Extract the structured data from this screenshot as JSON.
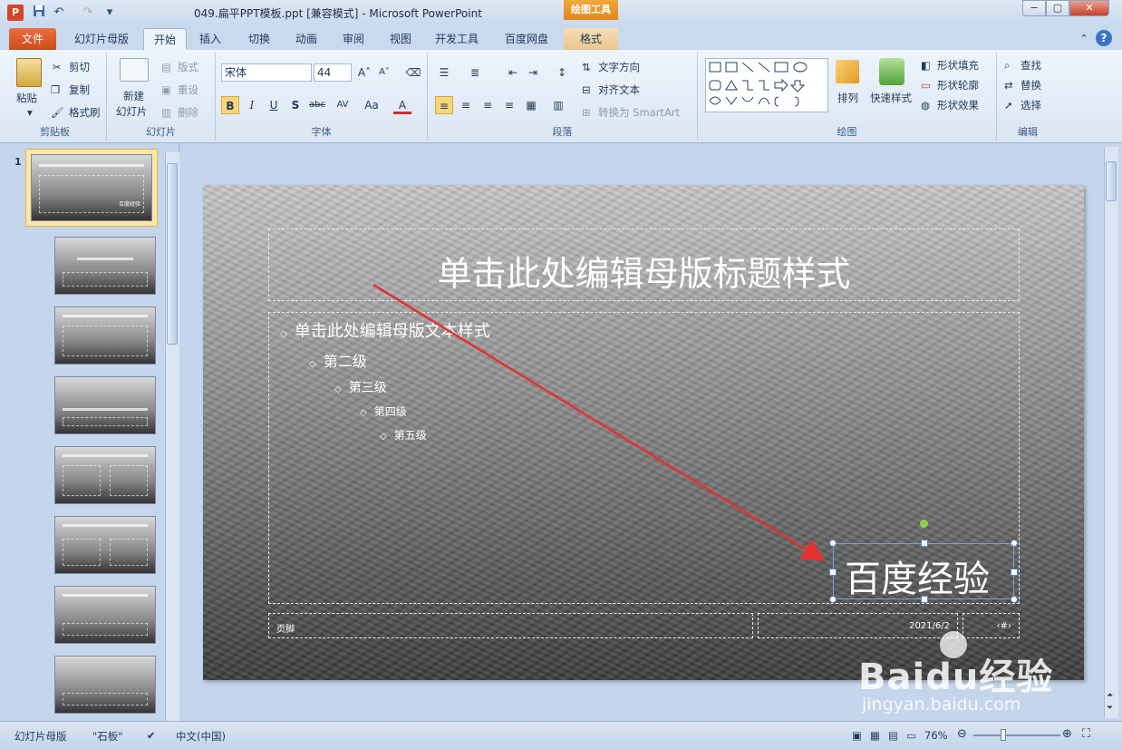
{
  "titlebar": {
    "app_icon_letter": "P",
    "doc_title": "049.扁平PPT模板.ppt [兼容模式] - Microsoft PowerPoint",
    "context_tool": "绘图工具",
    "minimize": "−",
    "maximize": "▢",
    "close": "✕"
  },
  "tabs": {
    "file": "文件",
    "slide_master": "幻灯片母版",
    "home": "开始",
    "insert": "插入",
    "transitions": "切换",
    "animations": "动画",
    "review": "审阅",
    "view": "视图",
    "developer": "开发工具",
    "baidu_disk": "百度网盘",
    "format": "格式"
  },
  "ribbon": {
    "clipboard": {
      "paste": "粘贴",
      "cut": "剪切",
      "copy": "复制",
      "format_painter": "格式刷",
      "label": "剪贴板"
    },
    "slides": {
      "new_slide_line1": "新建",
      "new_slide_line2": "幻灯片",
      "layout": "版式",
      "reset": "重设",
      "delete": "删除",
      "label": "幻灯片"
    },
    "font": {
      "font_name": "宋体",
      "font_size": "44",
      "bold": "B",
      "italic": "I",
      "underline": "U",
      "shadow": "S",
      "strike": "abc",
      "spacing": "AV",
      "case": "Aa",
      "color": "A",
      "label": "字体"
    },
    "paragraph": {
      "text_direction": "文字方向",
      "align_text": "对齐文本",
      "smartart": "转换为 SmartArt",
      "label": "段落"
    },
    "drawing": {
      "arrange": "排列",
      "quick_styles": "快速样式",
      "shape_fill": "形状填充",
      "shape_outline": "形状轮廓",
      "shape_effects": "形状效果",
      "label": "绘图"
    },
    "editing": {
      "find": "查找",
      "replace": "替换",
      "select": "选择",
      "label": "编辑"
    }
  },
  "thumbnails": {
    "first_number": "1",
    "first_caption": "百度经验"
  },
  "slide": {
    "title": "单击此处编辑母版标题样式",
    "levels": [
      "单击此处编辑母版文本样式",
      "第二级",
      "第三级",
      "第四级",
      "第五级"
    ],
    "bullet": "◇",
    "footer": "页脚",
    "date": "2021/6/2",
    "number": "‹#›",
    "wordart": "百度经验"
  },
  "statusbar": {
    "view_name": "幻灯片母版",
    "theme": "\"石板\"",
    "language": "中文(中国)",
    "zoom": "76%"
  },
  "watermark": {
    "brand": "Baidu经验",
    "url": "jingyan.baidu.com"
  },
  "colors": {
    "file_tab": "#d24726",
    "context_tab": "#e0861c",
    "arrow": "#e53030"
  }
}
